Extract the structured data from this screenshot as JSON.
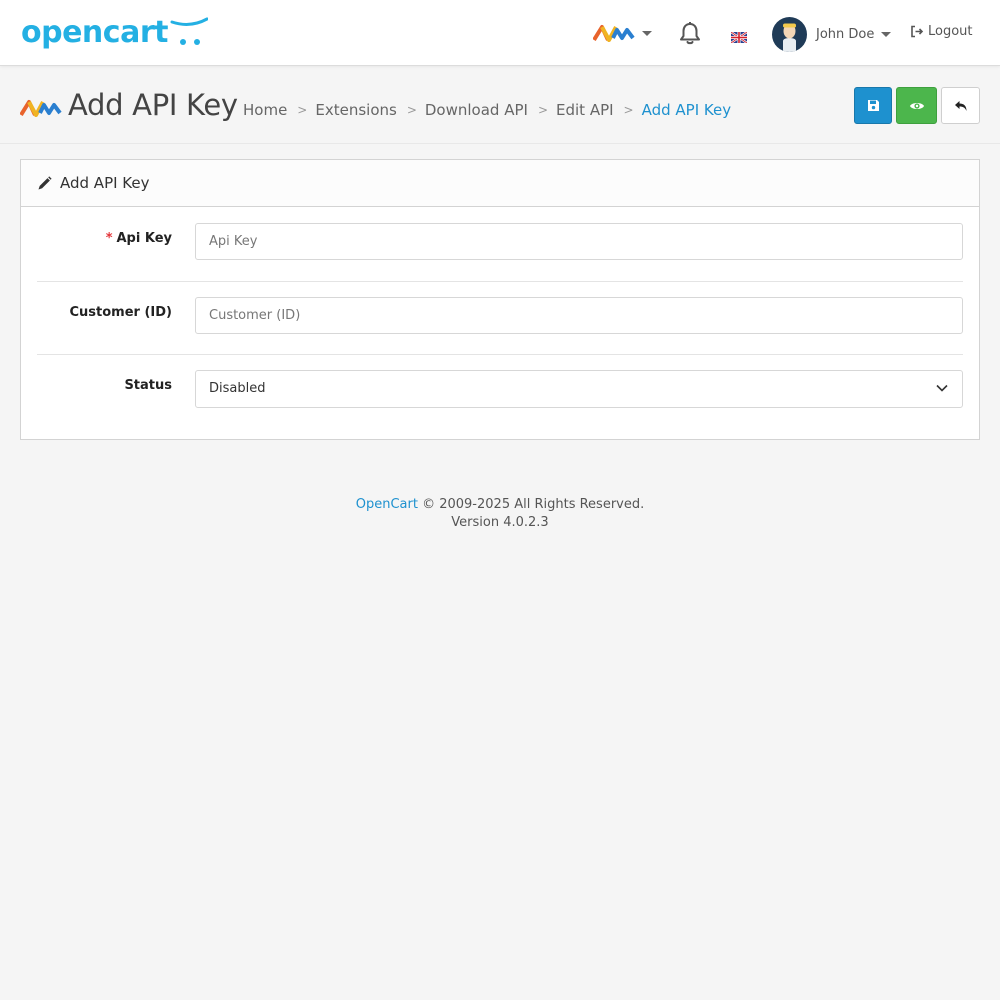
{
  "header": {
    "logo_text": "opencart",
    "user_name": "John Doe",
    "logout_label": "Logout",
    "icons": {
      "brand": "brand-mark-icon",
      "notifications": "bell-icon",
      "language": "uk-flag-icon",
      "logout": "sign-out-icon"
    }
  },
  "page": {
    "title": "Add API Key",
    "breadcrumb": [
      "Home",
      "Extensions",
      "Download API",
      "Edit API",
      "Add API Key"
    ],
    "buttons": {
      "save": "save-icon",
      "view": "eye-icon",
      "back": "reply-icon"
    }
  },
  "card": {
    "title": "Add API Key",
    "fields": {
      "api_key": {
        "label": "Api Key",
        "required": true,
        "placeholder": "Api Key",
        "value": ""
      },
      "customer_id": {
        "label": "Customer (ID)",
        "required": false,
        "placeholder": "Customer (ID)",
        "value": ""
      },
      "status": {
        "label": "Status",
        "selected": "Disabled"
      }
    }
  },
  "footer": {
    "link": "OpenCart",
    "copyright": "© 2009-2025 All Rights Reserved.",
    "version": "Version 4.0.2.3"
  },
  "colors": {
    "brand_blue": "#24b0e3",
    "primary": "#1e91cf",
    "success": "#4cb64c",
    "required": "#e3353a"
  }
}
